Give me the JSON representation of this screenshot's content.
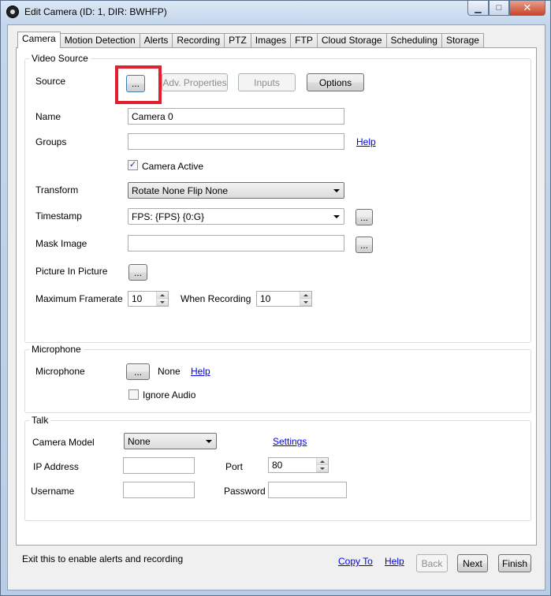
{
  "window": {
    "title": "Edit Camera (ID: 1, DIR: BWHFP)",
    "minimize_glyph": "▁",
    "maximize_glyph": "□",
    "close_glyph": "✕"
  },
  "tabs": [
    "Camera",
    "Motion Detection",
    "Alerts",
    "Recording",
    "PTZ",
    "Images",
    "FTP",
    "Cloud Storage",
    "Scheduling",
    "Storage"
  ],
  "video_source": {
    "title": "Video Source",
    "source_label": "Source",
    "source_button": "...",
    "adv_properties_button": "Adv. Properties",
    "inputs_button": "Inputs",
    "options_button": "Options",
    "name_label": "Name",
    "name_value": "Camera 0",
    "groups_label": "Groups",
    "groups_value": "",
    "groups_help": "Help",
    "camera_active_label": "Camera Active",
    "camera_active_checked": "✓",
    "transform_label": "Transform",
    "transform_value": "Rotate None Flip None",
    "timestamp_label": "Timestamp",
    "timestamp_value": "FPS: {FPS} {0:G}",
    "timestamp_button": "...",
    "mask_image_label": "Mask Image",
    "mask_image_value": "",
    "mask_image_button": "...",
    "pip_label": "Picture In Picture",
    "pip_button": "...",
    "max_framerate_label": "Maximum Framerate",
    "max_framerate_value": "10",
    "when_recording_label": "When Recording",
    "when_recording_value": "10"
  },
  "microphone": {
    "title": "Microphone",
    "label": "Microphone",
    "button": "...",
    "value": "None",
    "help": "Help",
    "ignore_audio_label": "Ignore Audio"
  },
  "talk": {
    "title": "Talk",
    "camera_model_label": "Camera Model",
    "camera_model_value": "None",
    "settings_link": "Settings",
    "ip_address_label": "IP Address",
    "ip_address_value": "",
    "port_label": "Port",
    "port_value": "80",
    "username_label": "Username",
    "username_value": "",
    "password_label": "Password",
    "password_value": ""
  },
  "footer": {
    "status_text": "Exit this to enable alerts and recording",
    "copy_to_link": "Copy To",
    "help_link": "Help",
    "back_button": "Back",
    "next_button": "Next",
    "finish_button": "Finish"
  },
  "colors": {
    "highlight_box": "#e0202c",
    "link": "#0000ee"
  }
}
